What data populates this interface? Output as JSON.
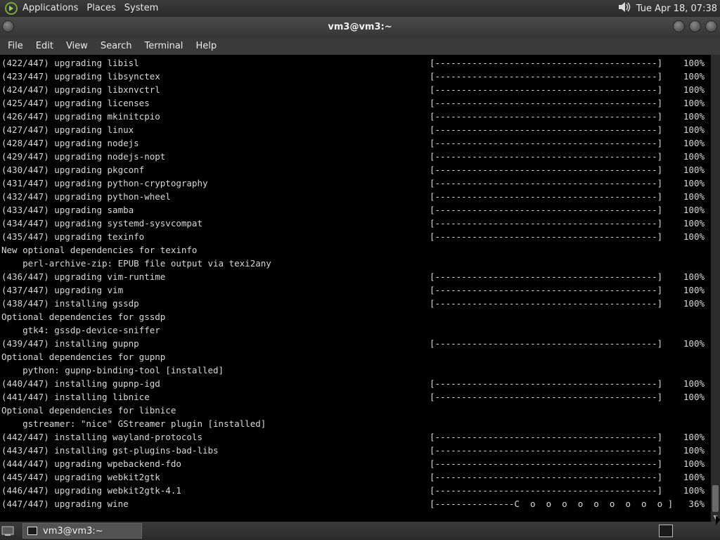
{
  "top_panel": {
    "menus": [
      "Applications",
      "Places",
      "System"
    ],
    "clock": "Tue Apr 18, 07:38",
    "volume_icon": "speaker-icon"
  },
  "window": {
    "title": "vm3@vm3:~",
    "menu": [
      "File",
      "Edit",
      "View",
      "Search",
      "Terminal",
      "Help"
    ]
  },
  "terminal": {
    "lines": [
      {
        "text": "(422/447) upgrading libisl",
        "bar": "[------------------------------------------]",
        "pct": "100%"
      },
      {
        "text": "(423/447) upgrading libsynctex",
        "bar": "[------------------------------------------]",
        "pct": "100%"
      },
      {
        "text": "(424/447) upgrading libxnvctrl",
        "bar": "[------------------------------------------]",
        "pct": "100%"
      },
      {
        "text": "(425/447) upgrading licenses",
        "bar": "[------------------------------------------]",
        "pct": "100%"
      },
      {
        "text": "(426/447) upgrading mkinitcpio",
        "bar": "[------------------------------------------]",
        "pct": "100%"
      },
      {
        "text": "(427/447) upgrading linux",
        "bar": "[------------------------------------------]",
        "pct": "100%"
      },
      {
        "text": "(428/447) upgrading nodejs",
        "bar": "[------------------------------------------]",
        "pct": "100%"
      },
      {
        "text": "(429/447) upgrading nodejs-nopt",
        "bar": "[------------------------------------------]",
        "pct": "100%"
      },
      {
        "text": "(430/447) upgrading pkgconf",
        "bar": "[------------------------------------------]",
        "pct": "100%"
      },
      {
        "text": "(431/447) upgrading python-cryptography",
        "bar": "[------------------------------------------]",
        "pct": "100%"
      },
      {
        "text": "(432/447) upgrading python-wheel",
        "bar": "[------------------------------------------]",
        "pct": "100%"
      },
      {
        "text": "(433/447) upgrading samba",
        "bar": "[------------------------------------------]",
        "pct": "100%"
      },
      {
        "text": "(434/447) upgrading systemd-sysvcompat",
        "bar": "[------------------------------------------]",
        "pct": "100%"
      },
      {
        "text": "(435/447) upgrading texinfo",
        "bar": "[------------------------------------------]",
        "pct": "100%"
      },
      {
        "text": "New optional dependencies for texinfo",
        "bar": "",
        "pct": ""
      },
      {
        "text": "    perl-archive-zip: EPUB file output via texi2any",
        "bar": "",
        "pct": ""
      },
      {
        "text": "(436/447) upgrading vim-runtime",
        "bar": "[------------------------------------------]",
        "pct": "100%"
      },
      {
        "text": "(437/447) upgrading vim",
        "bar": "[------------------------------------------]",
        "pct": "100%"
      },
      {
        "text": "(438/447) installing gssdp",
        "bar": "[------------------------------------------]",
        "pct": "100%"
      },
      {
        "text": "Optional dependencies for gssdp",
        "bar": "",
        "pct": ""
      },
      {
        "text": "    gtk4: gssdp-device-sniffer",
        "bar": "",
        "pct": ""
      },
      {
        "text": "(439/447) installing gupnp",
        "bar": "[------------------------------------------]",
        "pct": "100%"
      },
      {
        "text": "Optional dependencies for gupnp",
        "bar": "",
        "pct": ""
      },
      {
        "text": "    python: gupnp-binding-tool [installed]",
        "bar": "",
        "pct": ""
      },
      {
        "text": "(440/447) installing gupnp-igd",
        "bar": "[------------------------------------------]",
        "pct": "100%"
      },
      {
        "text": "(441/447) installing libnice",
        "bar": "[------------------------------------------]",
        "pct": "100%"
      },
      {
        "text": "Optional dependencies for libnice",
        "bar": "",
        "pct": ""
      },
      {
        "text": "    gstreamer: \"nice\" GStreamer plugin [installed]",
        "bar": "",
        "pct": ""
      },
      {
        "text": "(442/447) installing wayland-protocols",
        "bar": "[------------------------------------------]",
        "pct": "100%"
      },
      {
        "text": "(443/447) installing gst-plugins-bad-libs",
        "bar": "[------------------------------------------]",
        "pct": "100%"
      },
      {
        "text": "(444/447) upgrading wpebackend-fdo",
        "bar": "[------------------------------------------]",
        "pct": "100%"
      },
      {
        "text": "(445/447) upgrading webkit2gtk",
        "bar": "[------------------------------------------]",
        "pct": "100%"
      },
      {
        "text": "(446/447) upgrading webkit2gtk-4.1",
        "bar": "[------------------------------------------]",
        "pct": "100%"
      },
      {
        "text": "(447/447) upgrading wine",
        "bar": "[---------------C  o  o  o  o  o  o  o  o  o ]",
        "pct": "36%"
      }
    ]
  },
  "bottom_panel": {
    "task_label": "vm3@vm3:~"
  },
  "colors": {
    "terminal_bg": "#000000",
    "terminal_fg": "#d8d8d8",
    "panel_bg": "#333333"
  }
}
